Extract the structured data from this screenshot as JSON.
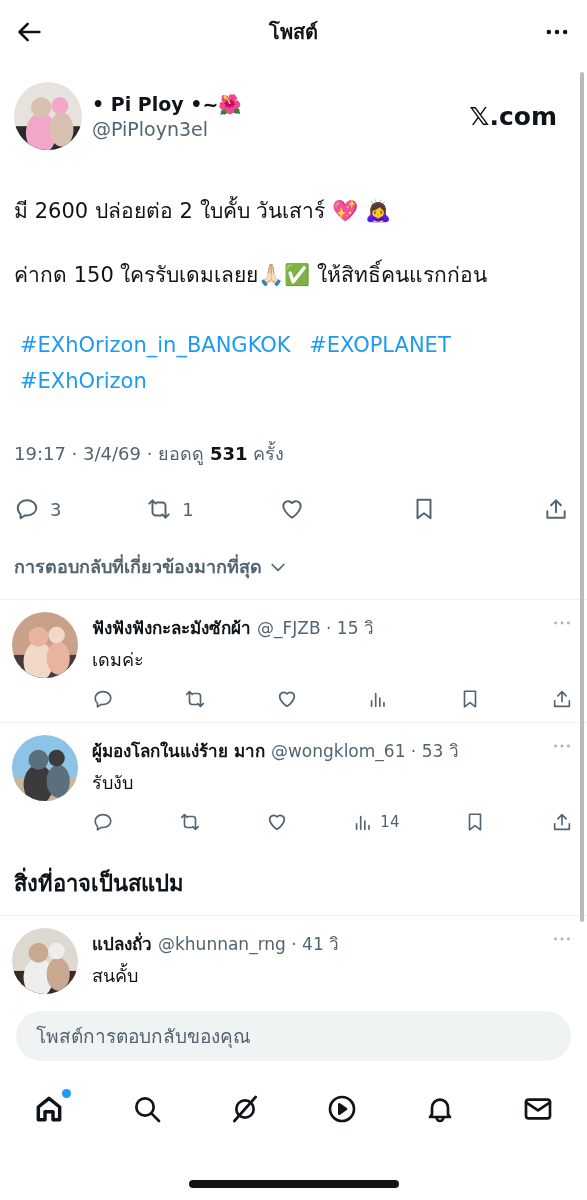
{
  "header": {
    "title": "โพสต์"
  },
  "post": {
    "author": {
      "name": "• Pi Ploy •~🌺",
      "handle": "@PiPloyn3el"
    },
    "source": "𝕏.com",
    "paragraphs": [
      "มี 2600 ปล่อยต่อ 2 ใบคั้บ วันเสาร์ 💖 🙇‍♀️",
      "ค่ากด 150 ใครรับเดมเลยย🙏🏻✅ ให้สิทธิ์คนแรกก่อน"
    ],
    "hashtags": [
      "#EXhOrizon_in_BANGKOK",
      "#EXOPLANET",
      "#EXhOrizon"
    ],
    "meta": "19:17 · 3/4/69 · ยอดดู **531** ครั้ง",
    "actions": [
      {
        "kind": "reply",
        "count": "3"
      },
      {
        "kind": "repost",
        "count": "1"
      },
      {
        "kind": "like"
      },
      {
        "kind": "bookmark"
      },
      {
        "kind": "share"
      }
    ]
  },
  "sort": {
    "label": "การตอบกลับที่เกี่ยวข้องมากที่สุด"
  },
  "replies": [
    {
      "name": "ฟังฟังฟังกะละมังซักผ้า",
      "handle_time": "@_FJZB · 15 วิ",
      "text": "เดมค่ะ"
    },
    {
      "name": "ผู้มองโลกในแง่ร้าย มาก",
      "handle_time": "@wongklom_61 · 53 วิ",
      "text": "รับงับ",
      "views": "14"
    }
  ],
  "spam": {
    "title": "สิ่งที่อาจเป็นสแปม",
    "replies": [
      {
        "name": "แปลงถั่ว",
        "handle_time": "@khunnan_rng · 41 วิ",
        "text": "สนคั้บ"
      }
    ]
  },
  "composer": {
    "placeholder": "โพสต์การตอบกลับของคุณ"
  },
  "tabs": [
    {
      "kind": "home",
      "selected": true,
      "badge": true
    },
    {
      "kind": "search",
      "selected": false,
      "badge": false
    },
    {
      "kind": "grok",
      "selected": false,
      "badge": false
    },
    {
      "kind": "video",
      "selected": false,
      "badge": false
    },
    {
      "kind": "notifications",
      "selected": false,
      "badge": false
    },
    {
      "kind": "messages",
      "selected": false,
      "badge": false
    }
  ]
}
